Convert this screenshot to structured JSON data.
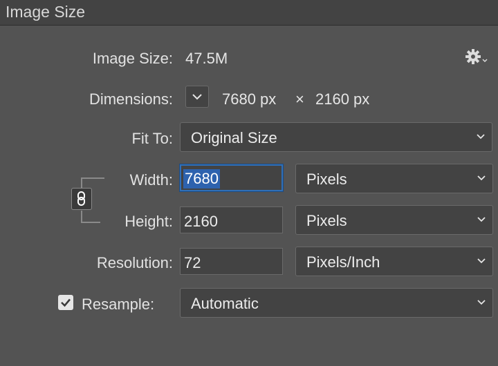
{
  "dialog": {
    "title": "Image Size"
  },
  "image_size": {
    "label": "Image Size:",
    "value": "47.5M"
  },
  "dimensions": {
    "label": "Dimensions:",
    "width": "7680 px",
    "separator": "×",
    "height": "2160 px"
  },
  "fit_to": {
    "label": "Fit To:",
    "selected": "Original Size"
  },
  "width": {
    "label": "Width:",
    "value": "7680",
    "unit": "Pixels"
  },
  "height": {
    "label": "Height:",
    "value": "2160",
    "unit": "Pixels"
  },
  "resolution": {
    "label": "Resolution:",
    "value": "72",
    "unit": "Pixels/Inch"
  },
  "resample": {
    "label": "Resample:",
    "checked": true,
    "selected": "Automatic"
  },
  "icons": {
    "settings": "gear-icon",
    "dimensions_menu": "chevron-down-icon",
    "constrain": "chain-link-icon",
    "checkbox": "checkmark-icon"
  },
  "colors": {
    "focus": "#2f6fb8",
    "selection": "#2d62ae",
    "panel": "#535353"
  }
}
